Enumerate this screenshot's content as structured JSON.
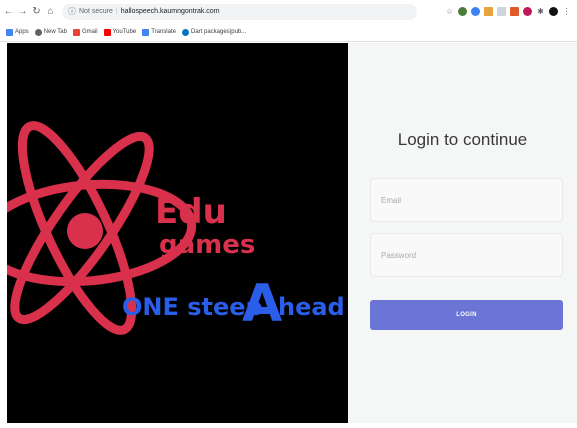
{
  "browser": {
    "url_status": "Not secure",
    "url": "hallospeech.kaumngontrak.com",
    "bookmarks": [
      {
        "label": "Apps",
        "color": "#4285f4"
      },
      {
        "label": "New Tab",
        "color": "#5f6368"
      },
      {
        "label": "Gmail",
        "color": "#ea4335"
      },
      {
        "label": "YouTube",
        "color": "#ff0000"
      },
      {
        "label": "Translate",
        "color": "#4285f4"
      },
      {
        "label": "Dart packages|pub...",
        "color": "#0175c2"
      }
    ]
  },
  "hero": {
    "logo_line1": "Edu",
    "logo_line2": "games",
    "logo_line3_a": "ONE steep",
    "logo_line3_b": "A",
    "logo_line3_c": "head",
    "color_primary": "#d9304c",
    "color_secondary": "#2a5ee8",
    "background": "#000000"
  },
  "login": {
    "title": "Login to continue",
    "email_placeholder": "Email",
    "password_placeholder": "Password",
    "button_label": "LOGIN",
    "button_color": "#6b75d6"
  }
}
